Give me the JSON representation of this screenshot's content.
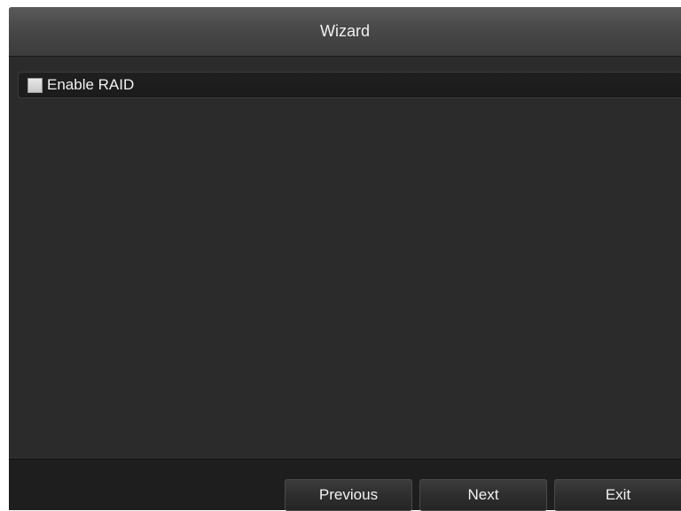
{
  "window": {
    "title": "Wizard"
  },
  "raid": {
    "label": "Enable RAID",
    "checked": false
  },
  "footer": {
    "previous_label": "Previous",
    "next_label": "Next",
    "exit_label": "Exit"
  },
  "colors": {
    "window_bg": "#2a2a2a",
    "title_bar": "#484848",
    "footer_bg": "#1e1e1e",
    "text": "#f2f2f2"
  }
}
